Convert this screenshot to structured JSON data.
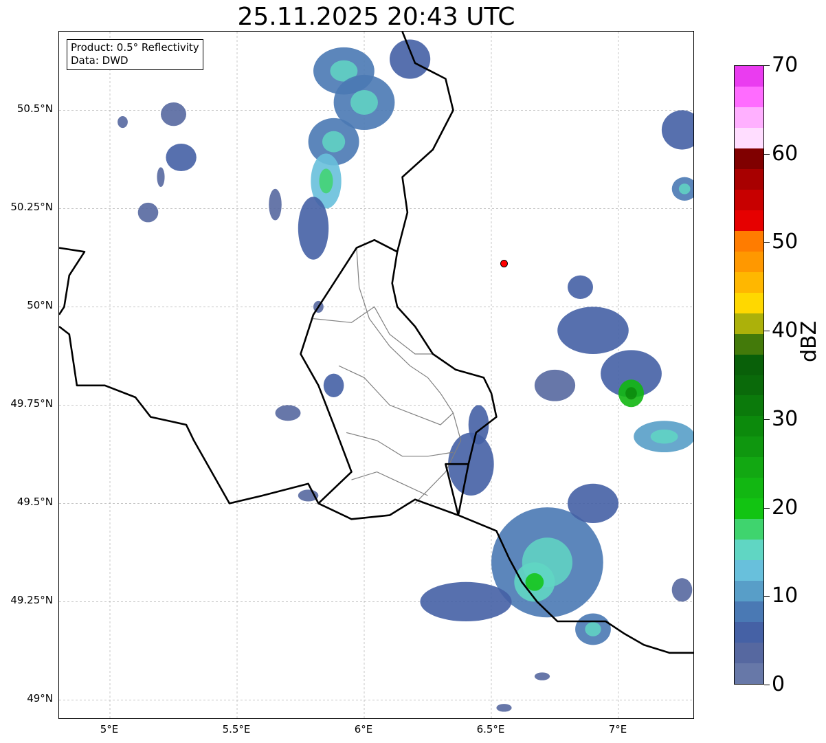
{
  "title": "25.11.2025 20:43 UTC",
  "info": {
    "product": "Product: 0.5° Reflectivity",
    "source": "Data: DWD"
  },
  "lat_ticks": [
    {
      "label": "50.5°N",
      "value": 50.5
    },
    {
      "label": "50.25°N",
      "value": 50.25
    },
    {
      "label": "50°N",
      "value": 50.0
    },
    {
      "label": "49.75°N",
      "value": 49.75
    },
    {
      "label": "49.5°N",
      "value": 49.5
    },
    {
      "label": "49.25°N",
      "value": 49.25
    },
    {
      "label": "49°N",
      "value": 49.0
    }
  ],
  "lon_ticks": [
    {
      "label": "5°E",
      "value": 5.0
    },
    {
      "label": "5.5°E",
      "value": 5.5
    },
    {
      "label": "6°E",
      "value": 6.0
    },
    {
      "label": "6.5°E",
      "value": 6.5
    },
    {
      "label": "7°E",
      "value": 7.0
    }
  ],
  "extent": {
    "lon_min": 4.8,
    "lon_max": 7.3,
    "lat_min": 48.95,
    "lat_max": 50.7
  },
  "radar_site": {
    "lon": 6.55,
    "lat": 50.11,
    "color": "#ff0000"
  },
  "colorbar": {
    "unit": "dBZ",
    "min": 0,
    "max": 70,
    "labels": [
      "70",
      "60",
      "50",
      "40",
      "30",
      "20",
      "10",
      "0"
    ],
    "label_values": [
      70,
      60,
      50,
      40,
      30,
      20,
      10,
      0
    ],
    "colors": [
      "#6778a8",
      "#5668a0",
      "#4561a5",
      "#4a79b4",
      "#589ec8",
      "#68c0dc",
      "#60d6c3",
      "#3fd46e",
      "#12c412",
      "#12b712",
      "#12a812",
      "#0f970f",
      "#0c8a0c",
      "#0b7a0b",
      "#0a6a0a",
      "#096009",
      "#437a0a",
      "#acb10a",
      "#ffd800",
      "#ffb700",
      "#ff9800",
      "#ff7c00",
      "#e60000",
      "#c80000",
      "#a80000",
      "#800000",
      "#ffddff",
      "#ffb0ff",
      "#ff6cff",
      "#ea3cf0"
    ]
  },
  "echoes": [
    {
      "lon": 5.25,
      "lat": 50.49,
      "rx": 0.05,
      "ry": 0.03,
      "dbz": 4
    },
    {
      "lon": 5.28,
      "lat": 50.38,
      "rx": 0.06,
      "ry": 0.035,
      "dbz": 6
    },
    {
      "lon": 5.05,
      "lat": 50.47,
      "rx": 0.02,
      "ry": 0.015,
      "dbz": 3
    },
    {
      "lon": 5.15,
      "lat": 50.24,
      "rx": 0.04,
      "ry": 0.025,
      "dbz": 4
    },
    {
      "lon": 5.2,
      "lat": 50.33,
      "rx": 0.015,
      "ry": 0.025,
      "dbz": 3
    },
    {
      "lon": 5.92,
      "lat": 50.6,
      "rx": 0.12,
      "ry": 0.06,
      "dbz": 8
    },
    {
      "lon": 6.0,
      "lat": 50.52,
      "rx": 0.12,
      "ry": 0.07,
      "dbz": 9
    },
    {
      "lon": 5.88,
      "lat": 50.42,
      "rx": 0.1,
      "ry": 0.06,
      "dbz": 8
    },
    {
      "lon": 5.85,
      "lat": 50.32,
      "rx": 0.06,
      "ry": 0.07,
      "dbz": 12
    },
    {
      "lon": 5.8,
      "lat": 50.2,
      "rx": 0.06,
      "ry": 0.08,
      "dbz": 6
    },
    {
      "lon": 6.18,
      "lat": 50.63,
      "rx": 0.08,
      "ry": 0.05,
      "dbz": 6
    },
    {
      "lon": 5.65,
      "lat": 50.26,
      "rx": 0.025,
      "ry": 0.04,
      "dbz": 3
    },
    {
      "lon": 7.25,
      "lat": 50.45,
      "rx": 0.08,
      "ry": 0.05,
      "dbz": 5
    },
    {
      "lon": 7.26,
      "lat": 50.3,
      "rx": 0.05,
      "ry": 0.03,
      "dbz": 8
    },
    {
      "lon": 6.9,
      "lat": 49.94,
      "rx": 0.14,
      "ry": 0.06,
      "dbz": 5
    },
    {
      "lon": 7.05,
      "lat": 49.83,
      "rx": 0.12,
      "ry": 0.06,
      "dbz": 6
    },
    {
      "lon": 7.05,
      "lat": 49.78,
      "rx": 0.05,
      "ry": 0.035,
      "dbz": 22
    },
    {
      "lon": 7.18,
      "lat": 49.67,
      "rx": 0.12,
      "ry": 0.04,
      "dbz": 10
    },
    {
      "lon": 6.75,
      "lat": 49.8,
      "rx": 0.08,
      "ry": 0.04,
      "dbz": 4
    },
    {
      "lon": 6.85,
      "lat": 50.05,
      "rx": 0.05,
      "ry": 0.03,
      "dbz": 5
    },
    {
      "lon": 5.88,
      "lat": 49.8,
      "rx": 0.04,
      "ry": 0.03,
      "dbz": 5
    },
    {
      "lon": 5.7,
      "lat": 49.73,
      "rx": 0.05,
      "ry": 0.02,
      "dbz": 4
    },
    {
      "lon": 6.42,
      "lat": 49.6,
      "rx": 0.09,
      "ry": 0.08,
      "dbz": 6
    },
    {
      "lon": 6.45,
      "lat": 49.7,
      "rx": 0.04,
      "ry": 0.05,
      "dbz": 5
    },
    {
      "lon": 6.72,
      "lat": 49.35,
      "rx": 0.22,
      "ry": 0.14,
      "dbz": 9
    },
    {
      "lon": 6.67,
      "lat": 49.3,
      "rx": 0.08,
      "ry": 0.05,
      "dbz": 14
    },
    {
      "lon": 6.9,
      "lat": 49.5,
      "rx": 0.1,
      "ry": 0.05,
      "dbz": 5
    },
    {
      "lon": 6.4,
      "lat": 49.25,
      "rx": 0.18,
      "ry": 0.05,
      "dbz": 6
    },
    {
      "lon": 6.9,
      "lat": 49.18,
      "rx": 0.07,
      "ry": 0.04,
      "dbz": 8
    },
    {
      "lon": 5.78,
      "lat": 49.52,
      "rx": 0.04,
      "ry": 0.015,
      "dbz": 4
    },
    {
      "lon": 7.25,
      "lat": 49.28,
      "rx": 0.04,
      "ry": 0.03,
      "dbz": 4
    },
    {
      "lon": 6.7,
      "lat": 49.06,
      "rx": 0.03,
      "ry": 0.01,
      "dbz": 3
    },
    {
      "lon": 6.55,
      "lat": 48.98,
      "rx": 0.03,
      "ry": 0.01,
      "dbz": 3
    },
    {
      "lon": 5.82,
      "lat": 50.0,
      "rx": 0.02,
      "ry": 0.015,
      "dbz": 3
    }
  ],
  "borders": {
    "country": [
      [
        [
          4.8,
          50.15
        ],
        [
          4.9,
          50.14
        ],
        [
          4.84,
          50.08
        ],
        [
          4.82,
          50.0
        ],
        [
          4.8,
          49.98
        ]
      ],
      [
        [
          4.8,
          49.95
        ],
        [
          4.84,
          49.93
        ],
        [
          4.87,
          49.8
        ],
        [
          4.98,
          49.8
        ],
        [
          5.1,
          49.77
        ],
        [
          5.16,
          49.72
        ],
        [
          5.3,
          49.7
        ],
        [
          5.33,
          49.66
        ],
        [
          5.47,
          49.5
        ],
        [
          5.6,
          49.52
        ],
        [
          5.78,
          49.55
        ],
        [
          5.82,
          49.5
        ],
        [
          5.95,
          49.46
        ],
        [
          6.1,
          49.47
        ],
        [
          6.2,
          49.51
        ],
        [
          6.37,
          49.47
        ],
        [
          6.52,
          49.43
        ],
        [
          6.57,
          49.36
        ],
        [
          6.62,
          49.3
        ],
        [
          6.68,
          49.25
        ],
        [
          6.76,
          49.2
        ],
        [
          6.85,
          49.2
        ],
        [
          6.95,
          49.2
        ],
        [
          7.02,
          49.17
        ],
        [
          7.1,
          49.14
        ],
        [
          7.2,
          49.12
        ],
        [
          7.3,
          49.12
        ]
      ],
      [
        [
          5.82,
          49.5
        ],
        [
          5.95,
          49.58
        ],
        [
          5.88,
          49.7
        ],
        [
          5.82,
          49.8
        ],
        [
          5.75,
          49.88
        ],
        [
          5.8,
          49.98
        ],
        [
          5.87,
          50.05
        ],
        [
          5.97,
          50.15
        ],
        [
          6.04,
          50.17
        ],
        [
          6.13,
          50.14
        ],
        [
          6.11,
          50.06
        ],
        [
          6.13,
          50.0
        ],
        [
          6.2,
          49.95
        ],
        [
          6.27,
          49.88
        ],
        [
          6.36,
          49.84
        ],
        [
          6.47,
          49.82
        ],
        [
          6.5,
          49.78
        ],
        [
          6.52,
          49.72
        ],
        [
          6.44,
          49.68
        ],
        [
          6.41,
          49.6
        ],
        [
          6.37,
          49.47
        ]
      ],
      [
        [
          6.13,
          50.14
        ],
        [
          6.17,
          50.24
        ],
        [
          6.15,
          50.33
        ],
        [
          6.27,
          50.4
        ],
        [
          6.35,
          50.5
        ],
        [
          6.32,
          50.58
        ],
        [
          6.2,
          50.62
        ],
        [
          6.15,
          50.7
        ]
      ],
      [
        [
          6.37,
          49.47
        ],
        [
          6.32,
          49.6
        ],
        [
          6.41,
          49.6
        ]
      ]
    ],
    "region": [
      [
        [
          5.97,
          50.15
        ],
        [
          5.98,
          50.05
        ],
        [
          6.02,
          49.97
        ],
        [
          6.1,
          49.9
        ],
        [
          6.18,
          49.85
        ],
        [
          6.25,
          49.82
        ],
        [
          6.3,
          49.78
        ],
        [
          6.35,
          49.73
        ],
        [
          6.38,
          49.66
        ],
        [
          6.32,
          49.58
        ],
        [
          6.2,
          49.5
        ]
      ],
      [
        [
          5.8,
          49.97
        ],
        [
          5.95,
          49.96
        ],
        [
          6.04,
          50.0
        ],
        [
          6.1,
          49.93
        ],
        [
          6.2,
          49.88
        ],
        [
          6.27,
          49.88
        ]
      ],
      [
        [
          5.9,
          49.85
        ],
        [
          6.0,
          49.82
        ],
        [
          6.1,
          49.75
        ],
        [
          6.22,
          49.72
        ],
        [
          6.3,
          49.7
        ],
        [
          6.35,
          49.73
        ]
      ],
      [
        [
          5.93,
          49.68
        ],
        [
          6.05,
          49.66
        ],
        [
          6.15,
          49.62
        ],
        [
          6.25,
          49.62
        ],
        [
          6.35,
          49.63
        ]
      ],
      [
        [
          5.95,
          49.56
        ],
        [
          6.05,
          49.58
        ],
        [
          6.15,
          49.55
        ],
        [
          6.25,
          49.52
        ]
      ]
    ]
  }
}
